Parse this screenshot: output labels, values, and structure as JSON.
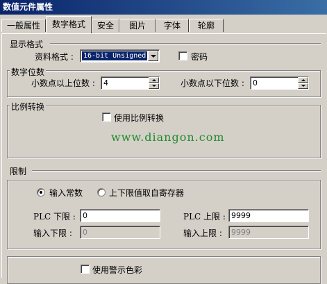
{
  "window": {
    "title": "数值元件属性"
  },
  "tabs": [
    "一般属性",
    "数字格式",
    "安全",
    "图片",
    "字体",
    "轮廓"
  ],
  "display_format": {
    "section_title": "显示格式",
    "format_label": "资料格式 :",
    "format_value": "16-bit Unsigned",
    "password_label": "密码",
    "password_checked": false
  },
  "digits": {
    "group_title": "数字位数",
    "upper_label": "小数点以上位数 :",
    "upper_value": "4",
    "lower_label": "小数点以下位数 :",
    "lower_value": "0"
  },
  "scaling": {
    "group_title": "比例转换",
    "enable_label": "使用比例转换",
    "enable_checked": false
  },
  "watermark": "www.diangon.com",
  "limits": {
    "section_title": "限制",
    "radio_constant": "输入常数",
    "radio_register": "上下限值取自寄存器",
    "selected": "constant",
    "plc_low_label": "PLC 下限 :",
    "plc_low_value": "0",
    "plc_high_label": "PLC 上限 :",
    "plc_high_value": "9999",
    "input_low_label": "输入下限 :",
    "input_low_value": "0",
    "input_high_label": "输入上限 :",
    "input_high_value": "9999"
  },
  "alarm": {
    "enable_label": "使用警示色彩",
    "enable_checked": false
  }
}
